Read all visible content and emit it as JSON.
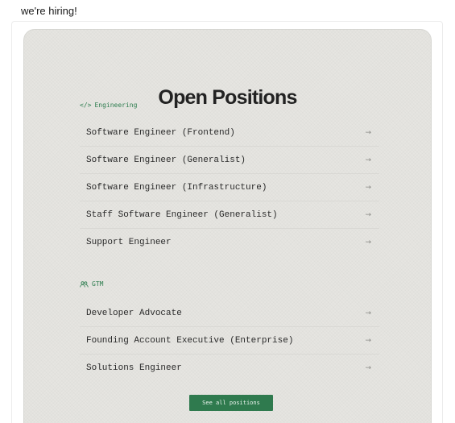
{
  "header": {
    "text": "we're hiring!"
  },
  "card": {
    "title": "Open Positions",
    "sections": [
      {
        "icon": "code-icon",
        "icon_glyph": "</>",
        "label": "Engineering",
        "items": [
          {
            "label": "Software Engineer (Frontend)",
            "arrow": "→"
          },
          {
            "label": "Software Engineer (Generalist)",
            "arrow": "→"
          },
          {
            "label": "Software Engineer (Infrastructure)",
            "arrow": "→"
          },
          {
            "label": "Staff Software Engineer (Generalist)",
            "arrow": "→"
          },
          {
            "label": "Support Engineer",
            "arrow": "→"
          }
        ]
      },
      {
        "icon": "users-icon",
        "label": "GTM",
        "items": [
          {
            "label": "Developer Advocate",
            "arrow": "→"
          },
          {
            "label": "Founding Account Executive (Enterprise)",
            "arrow": "→"
          },
          {
            "label": "Solutions Engineer",
            "arrow": "→"
          }
        ]
      }
    ],
    "cta_label": "See all positions"
  },
  "colors": {
    "accent": "#2f7a4e",
    "card_background": "#e6e5e1",
    "text": "#2a2a2a"
  }
}
